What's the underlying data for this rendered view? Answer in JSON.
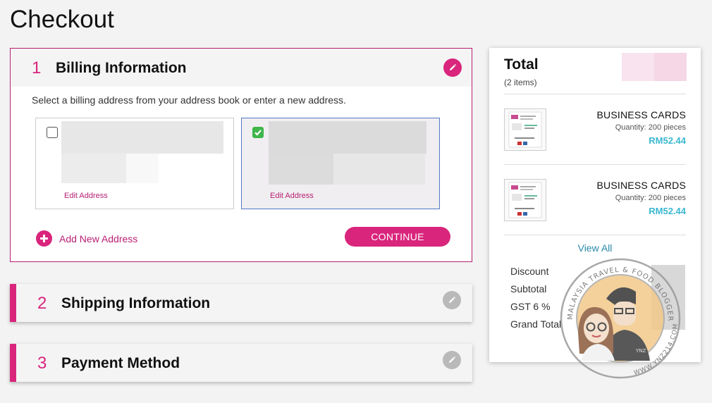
{
  "page": {
    "title": "Checkout"
  },
  "billing": {
    "step": "1",
    "title": "Billing Information",
    "intro": "Select a billing address from your address book or enter a new address.",
    "addresses": [
      {
        "edit_label": "Edit Address",
        "selected": false
      },
      {
        "edit_label": "Edit Address",
        "selected": true
      }
    ],
    "add_new_label": "Add New Address",
    "continue_label": "CONTINUE"
  },
  "shipping": {
    "step": "2",
    "title": "Shipping Information"
  },
  "payment": {
    "step": "3",
    "title": "Payment Method"
  },
  "total": {
    "title": "Total",
    "item_count": "(2 items)",
    "items": [
      {
        "name": "BUSINESS CARDS",
        "quantity": "Quantity: 200 pieces",
        "price": "RM52.44"
      },
      {
        "name": "BUSINESS CARDS",
        "quantity": "Quantity: 200 pieces",
        "price": "RM52.44"
      }
    ],
    "view_all": "View All",
    "summary": {
      "discount": "Discount",
      "subtotal": "Subtotal",
      "gst": "GST 6 %",
      "grand_total": "Grand Total"
    }
  },
  "watermark": {
    "text_top": "MALAYSIA TRAVEL & FOOD BLOGGER",
    "text_side": "WWW.YNZ214.COM",
    "badge": "YNZ"
  },
  "colors": {
    "accent": "#d9257c",
    "price": "#3bb8d2",
    "link": "#2a88a8",
    "check": "#3fb54a"
  }
}
